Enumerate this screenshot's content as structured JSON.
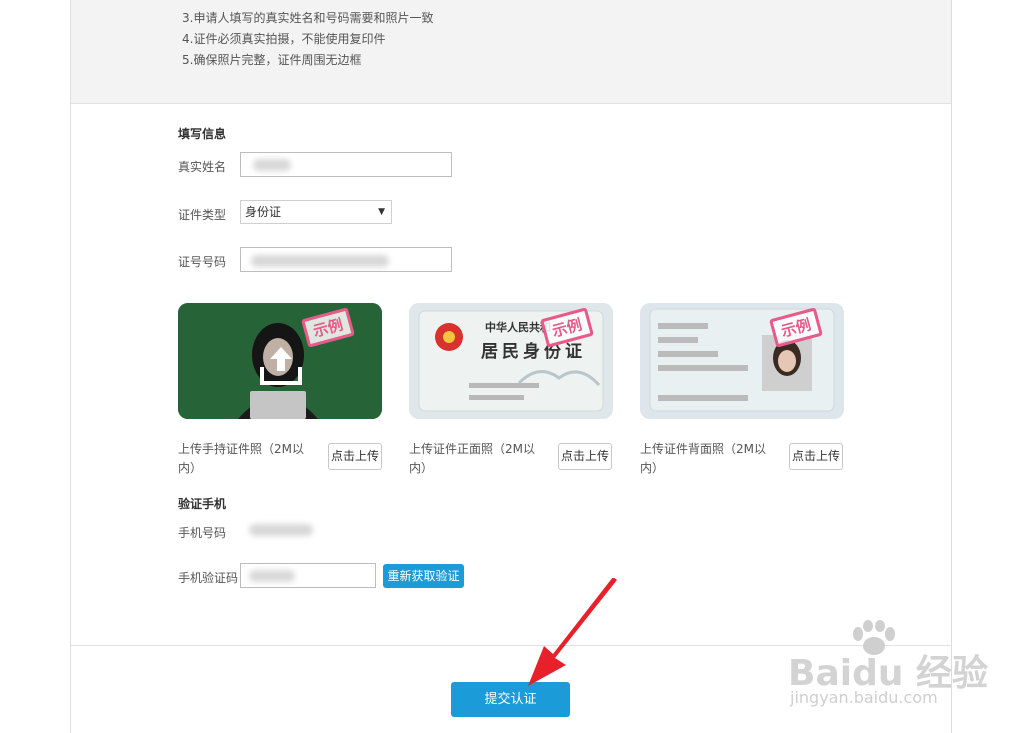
{
  "notice": {
    "lines": [
      "3.申请人填写的真实姓名和号码需要和照片一致",
      "4.证件必须真实拍摄，不能使用复印件",
      "5.确保照片完整，证件周围无边框"
    ]
  },
  "fill_info": {
    "title": "填写信息",
    "name_label": "真实姓名",
    "id_type_label": "证件类型",
    "id_type_value": "身份证",
    "id_number_label": "证号号码"
  },
  "uploads": [
    {
      "caption": "上传手持证件照（2M以内）",
      "button": "点击上传",
      "stamp": "示例"
    },
    {
      "caption": "上传证件正面照（2M以内）",
      "button": "点击上传",
      "stamp": "示例",
      "card_line1": "中华人民共和",
      "card_line2": "居民身份证"
    },
    {
      "caption": "上传证件背面照（2M以内）",
      "button": "点击上传",
      "stamp": "示例"
    }
  ],
  "phone": {
    "title": "验证手机",
    "phone_label": "手机号码",
    "code_label": "手机验证码",
    "resend_button": "重新获取验证"
  },
  "submit_button": "提交认证",
  "watermark": {
    "brand": "Baidu 经验",
    "url": "jingyan.baidu.com"
  },
  "colors": {
    "accent": "#1b9bd7",
    "stamp": "#e85a8a",
    "arrow": "#e8202a"
  }
}
